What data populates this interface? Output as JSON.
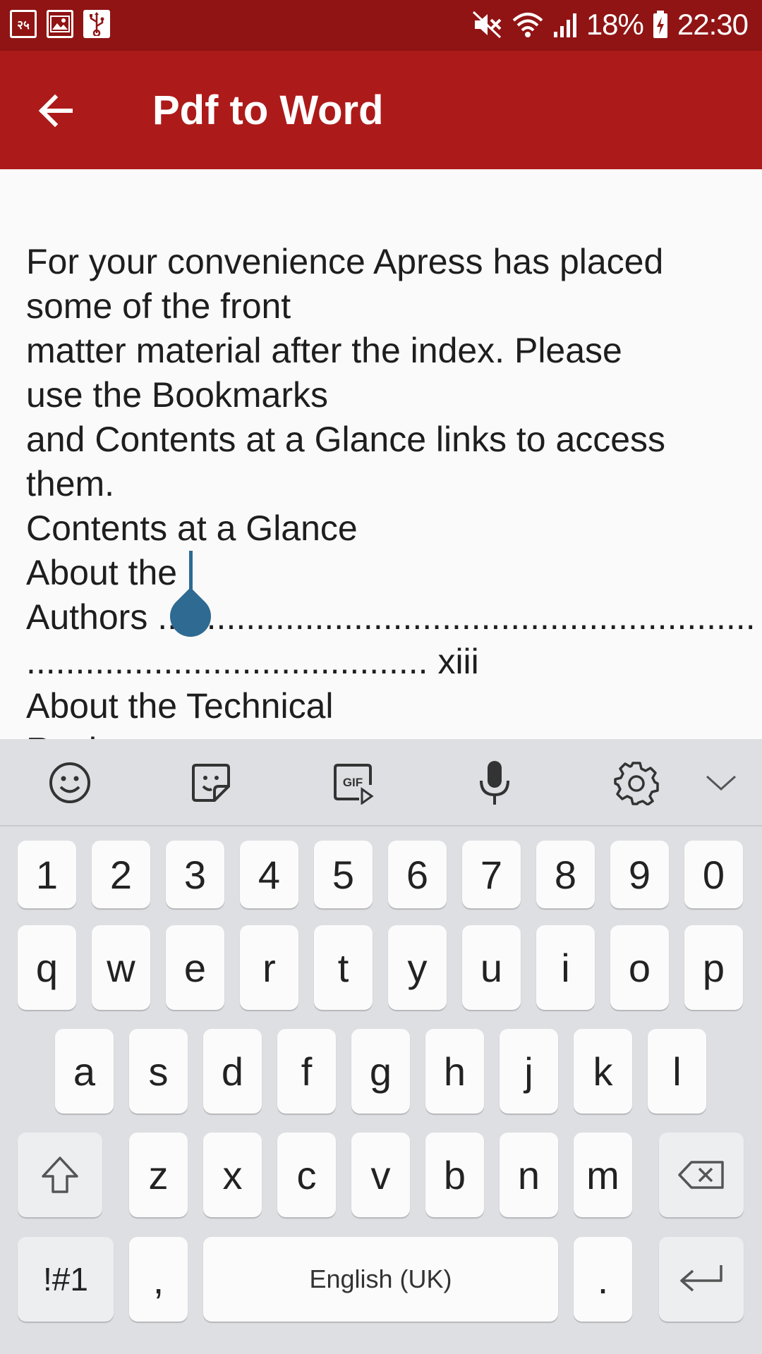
{
  "status_bar": {
    "notif_icon_1_text": "२५",
    "battery": "18%",
    "time": "22:30"
  },
  "app_bar": {
    "title": "Pdf to Word"
  },
  "document": {
    "lines": [
      "For your convenience Apress has placed",
      "some of the front",
      "matter material after the index. Please",
      "use the Bookmarks",
      "and Contents at a Glance links to access",
      "them.",
      "Contents at a Glance",
      "About the",
      "Authors .............................................................",
      "......................................... xiii",
      "About the Technical",
      "Reviewer"
    ]
  },
  "keyboard": {
    "toolbar": [
      "emoji-icon",
      "sticker-icon",
      "gif-icon",
      "microphone-icon",
      "settings-icon",
      "collapse-icon"
    ],
    "gif_label": "GIF",
    "row_numbers": [
      "1",
      "2",
      "3",
      "4",
      "5",
      "6",
      "7",
      "8",
      "9",
      "0"
    ],
    "row_1": [
      "q",
      "w",
      "e",
      "r",
      "t",
      "y",
      "u",
      "i",
      "o",
      "p"
    ],
    "row_2": [
      "a",
      "s",
      "d",
      "f",
      "g",
      "h",
      "j",
      "k",
      "l"
    ],
    "row_3": [
      "z",
      "x",
      "c",
      "v",
      "b",
      "n",
      "m"
    ],
    "symbols_label": "!#1",
    "comma": ",",
    "space_label": "English (UK)",
    "period": ".",
    "colors": {
      "accent": "#ad1a1a",
      "status": "#901414",
      "cursor": "#2e6a92"
    }
  }
}
